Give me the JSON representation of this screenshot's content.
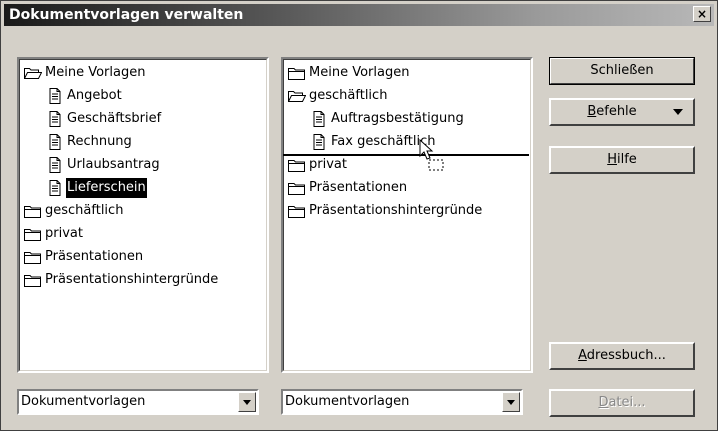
{
  "window": {
    "title": "Dokumentvorlagen verwalten",
    "close_label": "×"
  },
  "left_list": {
    "items": [
      {
        "label": "Meine Vorlagen",
        "icon": "folder-open-icon",
        "indent": 0
      },
      {
        "label": "Angebot",
        "icon": "document-icon",
        "indent": 1
      },
      {
        "label": "Geschäftsbrief",
        "icon": "document-icon",
        "indent": 1
      },
      {
        "label": "Rechnung",
        "icon": "document-icon",
        "indent": 1
      },
      {
        "label": "Urlaubsantrag",
        "icon": "document-icon",
        "indent": 1
      },
      {
        "label": "Lieferschein",
        "icon": "document-icon",
        "indent": 1,
        "selected": true
      },
      {
        "label": "geschäftlich",
        "icon": "folder-icon",
        "indent": 0
      },
      {
        "label": "privat",
        "icon": "folder-icon",
        "indent": 0
      },
      {
        "label": "Präsentationen",
        "icon": "folder-icon",
        "indent": 0
      },
      {
        "label": "Präsentationshintergründe",
        "icon": "folder-icon",
        "indent": 0
      }
    ],
    "combo_value": "Dokumentvorlagen"
  },
  "right_list": {
    "items": [
      {
        "label": "Meine Vorlagen",
        "icon": "folder-icon",
        "indent": 0
      },
      {
        "label": "geschäftlich",
        "icon": "folder-open-icon",
        "indent": 0
      },
      {
        "label": "Auftragsbestätigung",
        "icon": "document-icon",
        "indent": 1
      },
      {
        "label": "Fax geschäftlich",
        "icon": "document-icon",
        "indent": 1
      },
      {
        "label": "privat",
        "icon": "folder-icon",
        "indent": 0
      },
      {
        "label": "Präsentationen",
        "icon": "folder-icon",
        "indent": 0
      },
      {
        "label": "Präsentationshintergründe",
        "icon": "folder-icon",
        "indent": 0
      }
    ],
    "combo_value": "Dokumentvorlagen"
  },
  "buttons": {
    "close": "Schließen",
    "commands_mnemonic": "B",
    "commands_rest": "efehle",
    "help_mnemonic": "H",
    "help_rest": "ilfe",
    "addressbook_mnemonic": "A",
    "addressbook_rest": "dressbuch...",
    "file_mnemonic": "D",
    "file_rest": "atei..."
  }
}
